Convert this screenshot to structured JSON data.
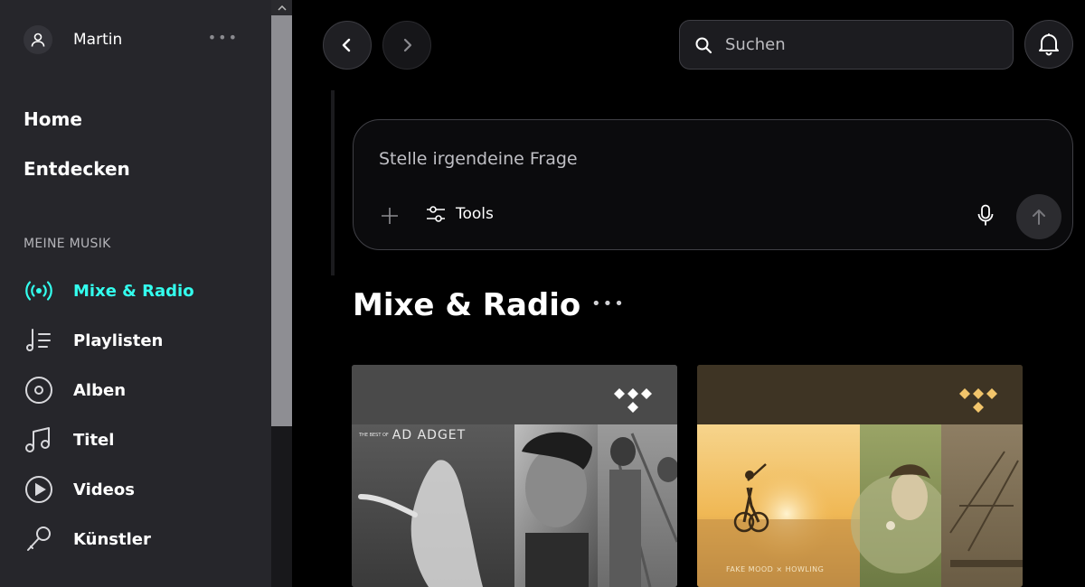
{
  "user": {
    "name": "Martin",
    "more": "•••"
  },
  "main_nav": [
    {
      "label": "Home"
    },
    {
      "label": "Entdecken"
    }
  ],
  "section_label": "MEINE MUSIK",
  "library": [
    {
      "label": "Mixe & Radio",
      "icon": "radio-icon",
      "active": true
    },
    {
      "label": "Playlisten",
      "icon": "playlist-icon",
      "active": false
    },
    {
      "label": "Alben",
      "icon": "album-icon",
      "active": false
    },
    {
      "label": "Titel",
      "icon": "music-note-icon",
      "active": false
    },
    {
      "label": "Videos",
      "icon": "video-icon",
      "active": false
    },
    {
      "label": "Künstler",
      "icon": "microphone-icon",
      "active": false
    }
  ],
  "search": {
    "placeholder": "Suchen"
  },
  "prompt": {
    "placeholder": "Stelle irgendeine Frage",
    "tools_label": "Tools"
  },
  "section": {
    "title": "Mixe & Radio",
    "more": "•••"
  },
  "cards": [
    {
      "art_text": "AD ADGET",
      "art_small": "THE BEST OF",
      "tidal_color": "#ffffff"
    },
    {
      "art_text": "FAKE MOOD × HOWLING",
      "tidal_color": "#f2c56b"
    }
  ],
  "colors": {
    "accent": "#33ffee",
    "sidebar_bg": "#26262b",
    "page_bg": "#000000"
  }
}
